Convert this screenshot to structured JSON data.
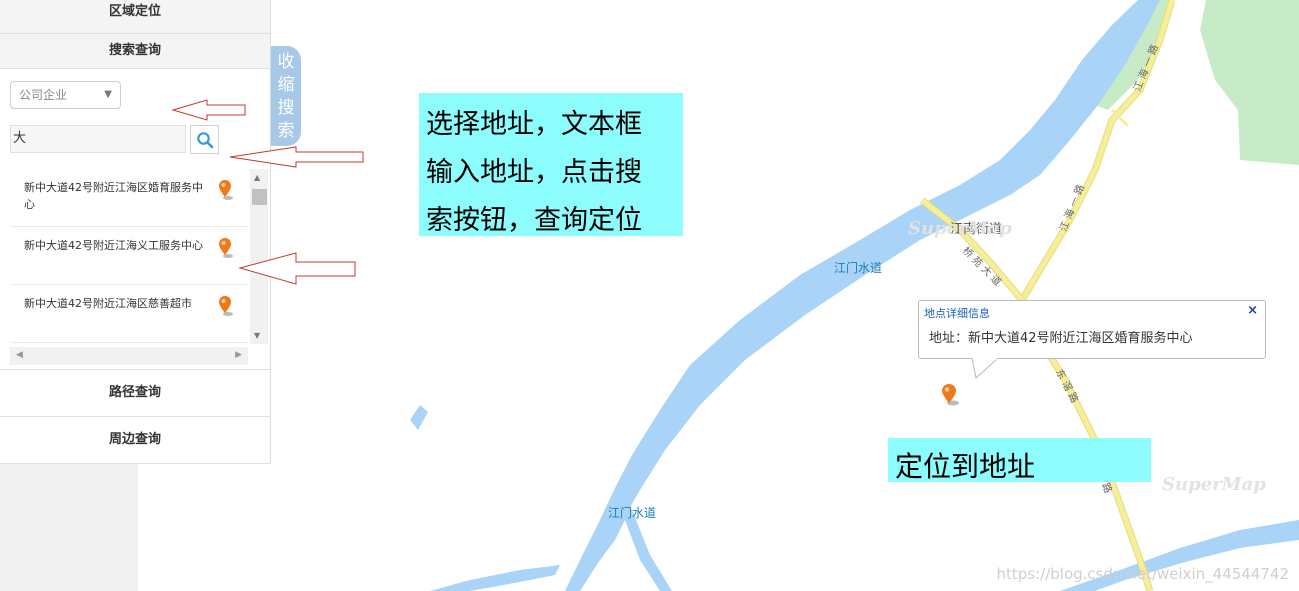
{
  "panel": {
    "area_locate": "区域定位",
    "search_query": "搜索查询",
    "route_query": "路径查询",
    "nearby_query": "周边查询",
    "category_select": "公司企业",
    "search_value": "大",
    "results": [
      "新中大道42号附近江海区婚育服务中心",
      "新中大道42号附近江海义工服务中心",
      "新中大道42号附近江海区慈善超市"
    ]
  },
  "collapse_tab": "收缩搜索",
  "annotations": {
    "note1": [
      "选择地址，文本框",
      "输入地址，点击搜",
      "索按钮，查询定位"
    ],
    "note2": "定位到地址"
  },
  "popup": {
    "title": "地点详细信息",
    "close": "×",
    "content": "地址：新中大道42号附近江海区婚育服务中心"
  },
  "map_labels": {
    "jiangnan_street": "江南街道",
    "waterway_1": "江门水道",
    "waterway_2": "江门水道",
    "road_qiao": "桥 苑 大 道",
    "road_jianghai": "江 海 一 路",
    "road_jianghai2": "江 海 一 路",
    "road_dongjian": "东 滘 路",
    "road_dong2": "路",
    "watermark": "SuperMap",
    "csdn": "https://blog.csdn.net/weixin_44544742"
  },
  "colors": {
    "river": "#a9d3f7",
    "park": "#c6ebc6",
    "road": "#f5ee9a",
    "note_bg": "#8cfcfc",
    "tab_bg": "#a8c8e8"
  }
}
